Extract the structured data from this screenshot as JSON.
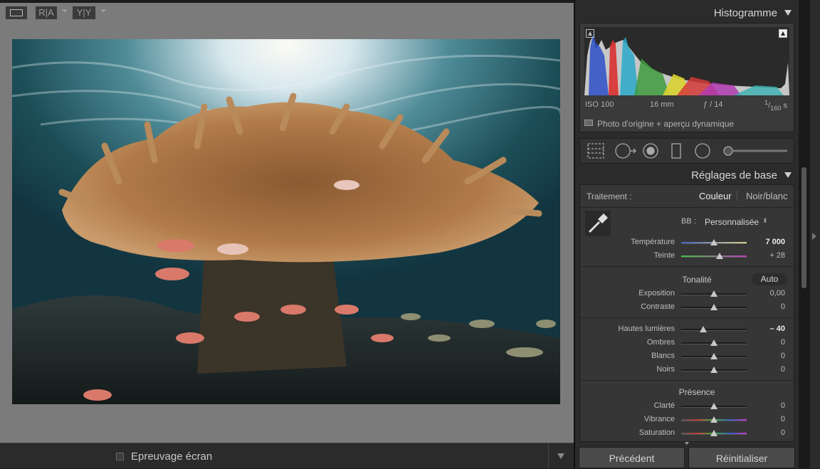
{
  "toolbar": {
    "view_icon": "loupe-view-icon",
    "compare_ra": "R|A",
    "compare_yy": "Y|Y",
    "proof_label": "Epreuvage écran"
  },
  "panel": {
    "histogram": {
      "title": "Histogramme",
      "iso": "ISO 100",
      "focal": "16 mm",
      "aperture": "ƒ / 14",
      "shutter_num": "1",
      "shutter_den": "160",
      "shutter_unit": "s",
      "original_label": "Photo d'origine + aperçu dynamique"
    },
    "tools": [
      "crop-icon",
      "spot-removal-icon",
      "red-eye-icon",
      "graduated-filter-icon",
      "radial-filter-icon",
      "adjustment-brush-icon"
    ],
    "basic": {
      "title": "Réglages de base",
      "treatment_label": "Traitement :",
      "treatment_color": "Couleur",
      "treatment_bw": "Noir/blanc",
      "wb_label": "BB :",
      "wb_value": "Personnalisée",
      "temp_label": "Température",
      "temp_value": "7 000",
      "tint_label": "Teinte",
      "tint_value": "+ 28",
      "tone_title": "Tonalité",
      "auto_label": "Auto",
      "exposure_label": "Exposition",
      "exposure_value": "0,00",
      "contrast_label": "Contraste",
      "contrast_value": "0",
      "highlights_label": "Hautes lumières",
      "highlights_value": "– 40",
      "shadows_label": "Ombres",
      "shadows_value": "0",
      "whites_label": "Blancs",
      "whites_value": "0",
      "blacks_label": "Noirs",
      "blacks_value": "0",
      "presence_title": "Présence",
      "clarity_label": "Clarté",
      "clarity_value": "0",
      "vibrance_label": "Vibrance",
      "vibrance_value": "0",
      "saturation_label": "Saturation",
      "saturation_value": "0"
    },
    "buttons": {
      "previous": "Précédent",
      "reset": "Réinitialiser"
    }
  },
  "colors": {
    "viewer_bg": "#7b7b7b",
    "panel_bg": "#2b2b2b",
    "accent_text": "#d6d6d6"
  }
}
